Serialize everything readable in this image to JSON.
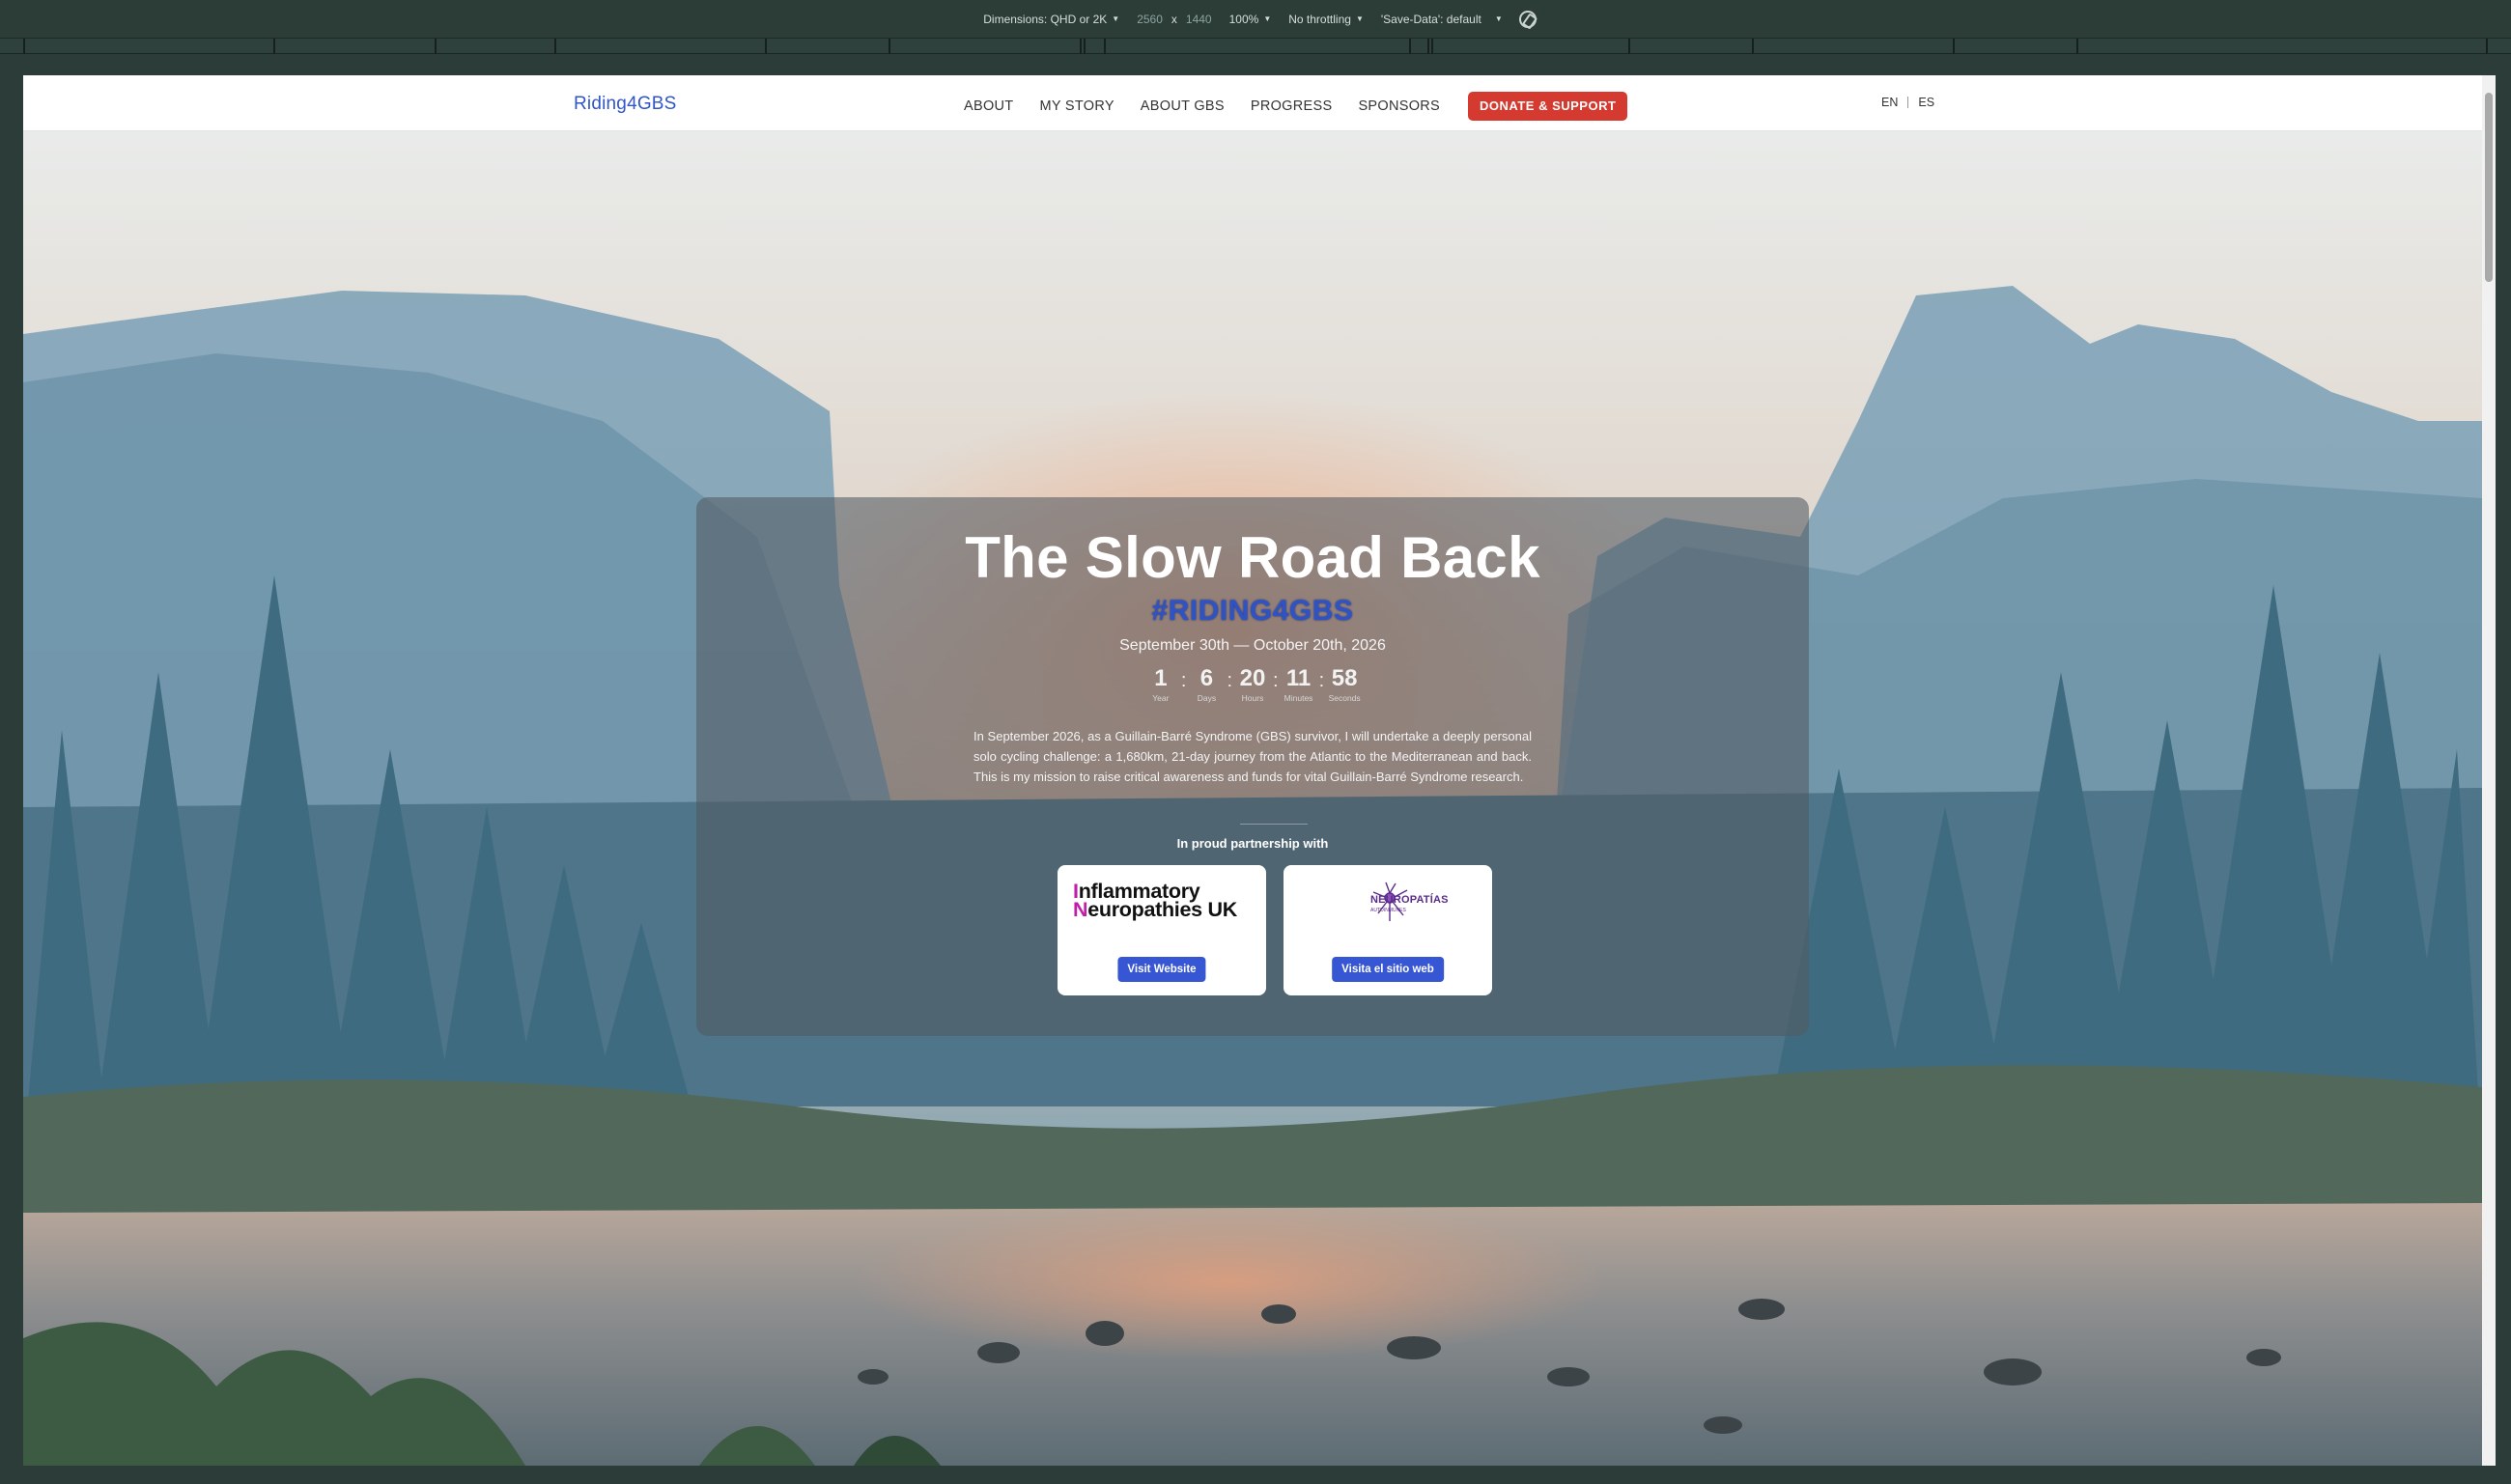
{
  "devtools": {
    "dimensions_label": "Dimensions: QHD or 2K",
    "width": "2560",
    "times": "x",
    "height": "1440",
    "zoom": "100%",
    "throttling": "No throttling",
    "save_data": "'Save-Data': default"
  },
  "nav": {
    "logo": "Riding4GBS",
    "links": [
      "ABOUT",
      "MY STORY",
      "ABOUT GBS",
      "PROGRESS",
      "SPONSORS"
    ],
    "donate": "DONATE & SUPPORT",
    "lang_en": "EN",
    "lang_es": "ES"
  },
  "hero": {
    "title": "The Slow Road Back",
    "hashtag": "#RIDING4GBS",
    "dates": "September 30th — October 20th, 2026",
    "countdown": [
      {
        "value": "1",
        "label": "Year"
      },
      {
        "value": "6",
        "label": "Days"
      },
      {
        "value": "20",
        "label": "Hours"
      },
      {
        "value": "11",
        "label": "Minutes"
      },
      {
        "value": "58",
        "label": "Seconds"
      }
    ],
    "separator": ":",
    "description": "In September 2026, as a Guillain-Barré Syndrome (GBS) survivor, I will undertake a deeply personal solo cycling challenge: a 1,680km, 21-day journey from the Atlantic to the Mediterranean and back. This is my mission to raise critical awareness and funds for vital Guillain-Barré Syndrome research.",
    "partner_heading": "In proud partnership with",
    "partners": [
      {
        "logo_line1_initial": "I",
        "logo_line1_rest": "nflammatory",
        "logo_line2_initial": "N",
        "logo_line2_rest": "europathies UK",
        "button": "Visit Website"
      },
      {
        "logo_text": "NEUROPATÍAS",
        "logo_sub": "AUTOINMUNES",
        "button": "Visita el sitio web"
      }
    ]
  },
  "colors": {
    "accent_blue": "#3656d3",
    "donate_red": "#d43a2f",
    "logo_magenta": "#c21fa8",
    "neuro_purple": "#5b2c8a"
  }
}
